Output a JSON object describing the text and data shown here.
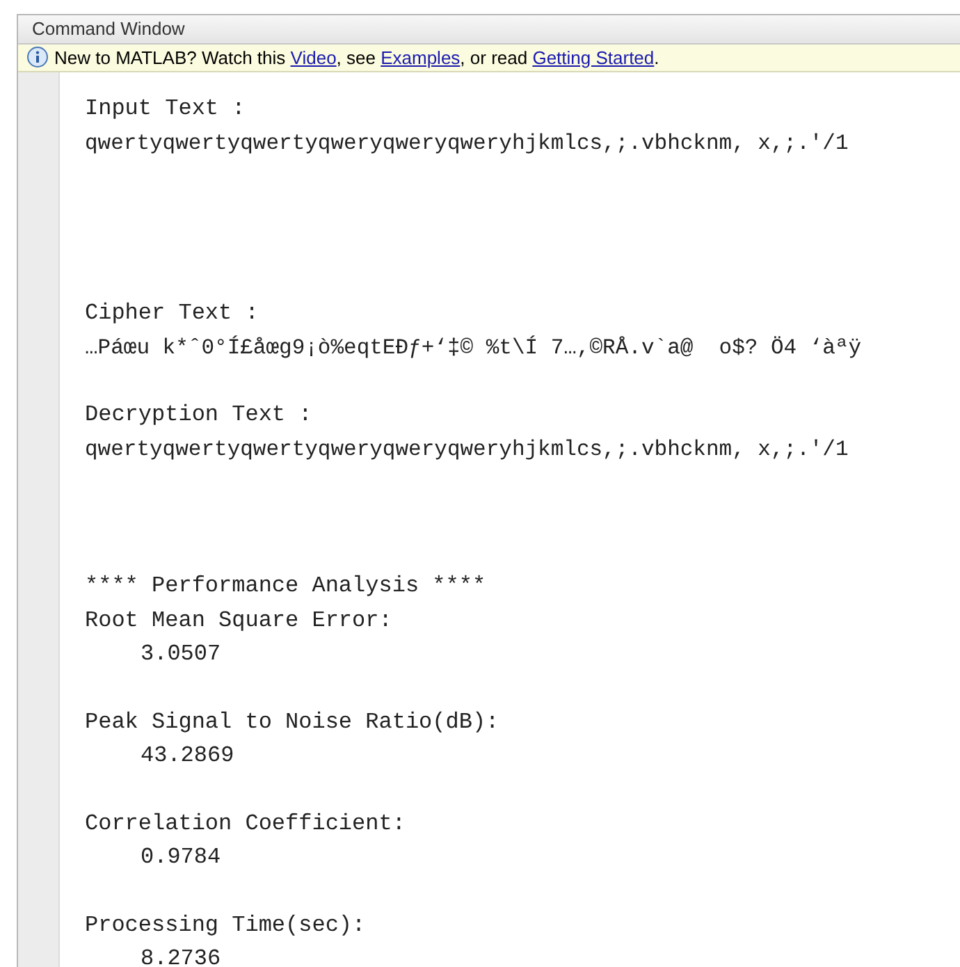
{
  "window": {
    "title": "Command Window"
  },
  "info_bar": {
    "segments": [
      {
        "kind": "text",
        "text": "New to MATLAB? Watch this "
      },
      {
        "kind": "link",
        "text": "Video"
      },
      {
        "kind": "text",
        "text": ", see "
      },
      {
        "kind": "link",
        "text": "Examples"
      },
      {
        "kind": "text",
        "text": ", or read "
      },
      {
        "kind": "link",
        "text": "Getting Started"
      },
      {
        "kind": "text",
        "text": "."
      }
    ]
  },
  "output": [
    {
      "lines": [
        {
          "kind": "label",
          "text": "Input Text :"
        },
        {
          "kind": "value",
          "text": "qwertyqwertyqwertyqweryqweryqweryhjkmlcs,;.vbhcknm, x,;.'/1"
        }
      ]
    },
    {
      "lines": [
        {
          "kind": "label",
          "text": "Cipher Text :"
        },
        {
          "kind": "value",
          "text": "…Páœu k*ˆ0°Í£åœg9¡ò%eqtEÐƒ+‘‡© %t\\Í 7…,©RÅ.v`a@  o$? Ö4 ‘àªÿ"
        }
      ]
    },
    {
      "lines": [
        {
          "kind": "label",
          "text": "Decryption Text :"
        },
        {
          "kind": "value",
          "text": "qwertyqwertyqwertyqweryqweryqweryhjkmlcs,;.vbhcknm, x,;.'/1"
        }
      ]
    },
    {
      "lines": [
        {
          "kind": "heading",
          "text": "**** Performance Analysis ****"
        },
        {
          "kind": "label",
          "text": "Root Mean Square Error:"
        },
        {
          "kind": "number",
          "text": "3.0507"
        }
      ]
    },
    {
      "lines": [
        {
          "kind": "label",
          "text": "Peak Signal to Noise Ratio(dB):"
        },
        {
          "kind": "number",
          "text": "43.2869"
        }
      ]
    },
    {
      "lines": [
        {
          "kind": "label",
          "text": "Correlation Coefficient:"
        },
        {
          "kind": "number",
          "text": "0.9784"
        }
      ]
    },
    {
      "lines": [
        {
          "kind": "label",
          "text": "Processing Time(sec):"
        },
        {
          "kind": "number",
          "text": "8.2736"
        }
      ]
    }
  ]
}
